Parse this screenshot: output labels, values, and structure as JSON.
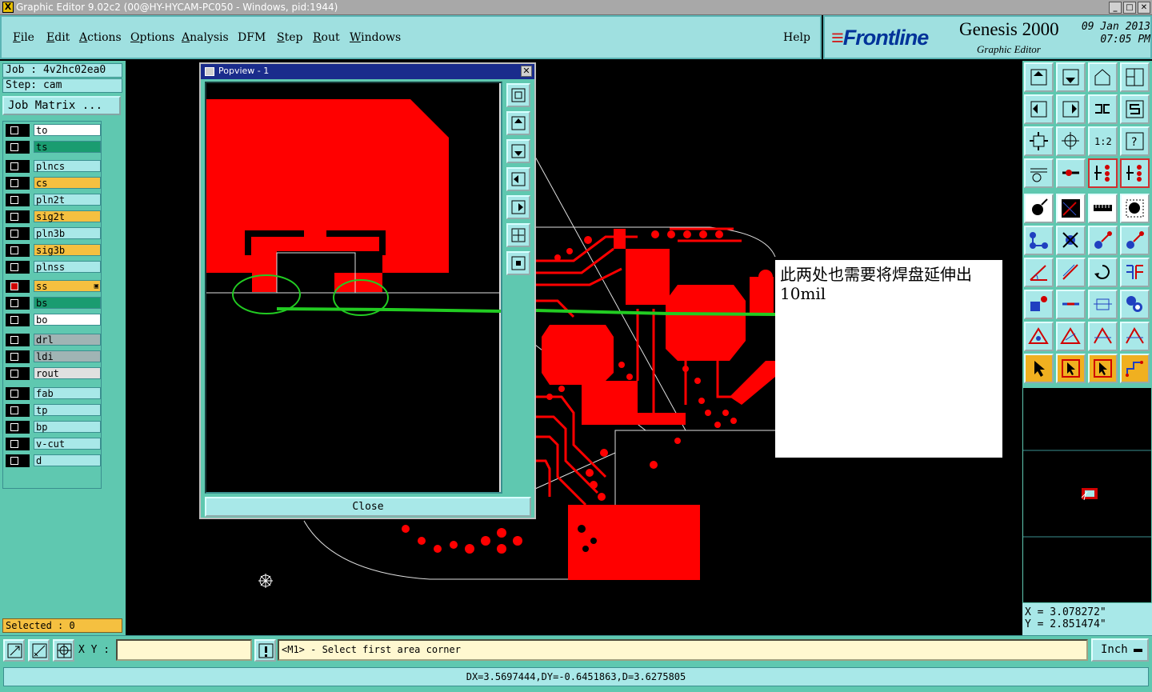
{
  "window": {
    "title": "Graphic Editor 9.02c2 (00@HY-HYCAM-PC050 - Windows, pid:1944)"
  },
  "menu": {
    "items": [
      {
        "label": "File",
        "underline": "F",
        "rest": "ile"
      },
      {
        "label": "Edit",
        "underline": "E",
        "rest": "dit"
      },
      {
        "label": "Actions",
        "underline": "A",
        "rest": "ctions"
      },
      {
        "label": "Options",
        "underline": "O",
        "rest": "ptions"
      },
      {
        "label": "Analysis",
        "underline": "A",
        "rest": "nalysis"
      },
      {
        "label": "DFM",
        "underline": "",
        "rest": "DFM"
      },
      {
        "label": "Step",
        "underline": "S",
        "rest": "tep"
      },
      {
        "label": "Rout",
        "underline": "R",
        "rest": "out"
      },
      {
        "label": "Windows",
        "underline": "W",
        "rest": "indows"
      }
    ],
    "help": "Help"
  },
  "brand": {
    "logo": "Frontline",
    "product": "Genesis 2000",
    "subtitle": "Graphic Editor",
    "date": "09 Jan 2013",
    "time": "07:05 PM"
  },
  "job": {
    "job_label": "Job : 4v2hc02ea0",
    "step_label": "Step: cam",
    "matrix_button": "Job Matrix ..."
  },
  "layers": [
    {
      "name": "to",
      "color": "#ffffff",
      "active": false
    },
    {
      "name": "ts",
      "color": "#1a9c70",
      "active": false
    },
    {
      "name": "plncs",
      "color": "#a8e8e8",
      "active": false
    },
    {
      "name": "cs",
      "color": "#f5c040",
      "active": false
    },
    {
      "name": "pln2t",
      "color": "#a8e8e8",
      "active": false
    },
    {
      "name": "sig2t",
      "color": "#f5c040",
      "active": false
    },
    {
      "name": "pln3b",
      "color": "#a8e8e8",
      "active": false
    },
    {
      "name": "sig3b",
      "color": "#f5c040",
      "active": false
    },
    {
      "name": "plnss",
      "color": "#a8e8e8",
      "active": false
    },
    {
      "name": "ss",
      "color": "#f5c040",
      "active": true
    },
    {
      "name": "bs",
      "color": "#1a9c70",
      "active": false
    },
    {
      "name": "bo",
      "color": "#ffffff",
      "active": false
    },
    {
      "name": "drl",
      "color": "#a0b4b4",
      "active": false
    },
    {
      "name": "ldi",
      "color": "#a0b4b4",
      "active": false
    },
    {
      "name": "rout",
      "color": "#e0e0e0",
      "active": false
    },
    {
      "name": "fab",
      "color": "#a8e8e8",
      "active": false
    },
    {
      "name": "tp",
      "color": "#a8e8e8",
      "active": false
    },
    {
      "name": "bp",
      "color": "#a8e8e8",
      "active": false
    },
    {
      "name": "v-cut",
      "color": "#a8e8e8",
      "active": false
    },
    {
      "name": "d",
      "color": "#a8e8e8",
      "active": false
    }
  ],
  "selected_label": "Selected : 0",
  "popview": {
    "title": "Popview - 1",
    "close_button": "Close"
  },
  "annotation": {
    "text": "此两处也需要将焊盘延伸出10mil"
  },
  "coords": {
    "x": "X = 3.078272\"",
    "y": "Y = 2.851474\""
  },
  "bottom": {
    "xy_label": "X Y :",
    "xy_value": "",
    "prompt": "<M1> - Select first area corner",
    "units": "Inch",
    "status": "DX=3.5697444,DY=-0.6451863,D=3.6275805"
  },
  "colors": {
    "copper": "#ff0000",
    "panel": "#5fc8b0",
    "button": "#a8e8e8",
    "highlight": "#22cc22"
  }
}
